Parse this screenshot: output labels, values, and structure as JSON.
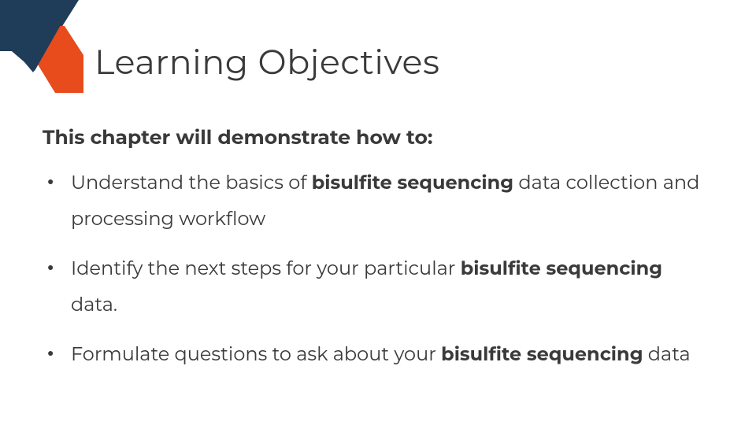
{
  "title": "Learning Objectives",
  "subtitle": "This chapter will demonstrate how to:",
  "bullets": [
    {
      "pre": "Understand the basics of ",
      "bold": "bisulfite sequencing",
      "post": " data collection and processing workflow"
    },
    {
      "pre": " Identify the next steps for your particular ",
      "bold": "bisulfite sequencing",
      "post": " data."
    },
    {
      "pre": "Formulate questions to ask about your ",
      "bold": "bisulfite sequencing",
      "post": " data"
    }
  ],
  "colors": {
    "navy": "#1f3d58",
    "orange": "#e84b1c"
  }
}
